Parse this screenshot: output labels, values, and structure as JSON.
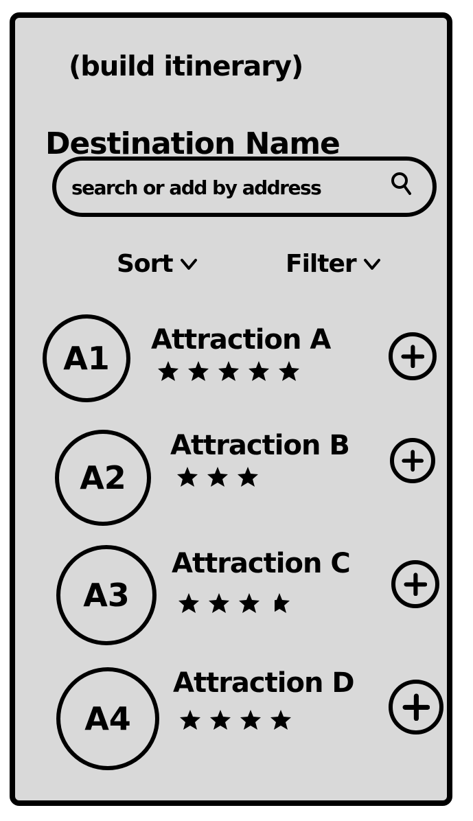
{
  "header": {
    "title": "(build itinerary)",
    "destination": "Destination Name"
  },
  "search": {
    "placeholder": "search or add by address",
    "icon": "search-icon"
  },
  "controls": {
    "sort_label": "Sort",
    "filter_label": "Filter",
    "chevron_icon": "chevron-down-icon"
  },
  "attractions": [
    {
      "avatar": "A1",
      "name": "Attraction A",
      "rating": 5
    },
    {
      "avatar": "A2",
      "name": "Attraction B",
      "rating": 3
    },
    {
      "avatar": "A3",
      "name": "Attraction C",
      "rating": 3.5
    },
    {
      "avatar": "A4",
      "name": "Attraction D",
      "rating": 4
    }
  ],
  "add_icon": "plus-circle-icon"
}
